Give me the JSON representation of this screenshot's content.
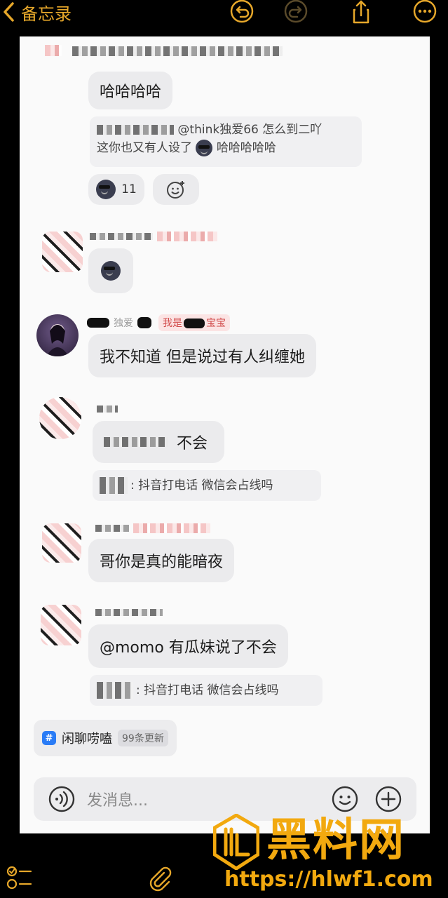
{
  "topbar": {
    "back_label": "备忘录"
  },
  "messages": {
    "m1_text": "哈哈哈哈",
    "m1_quote_ref": "@think独爱66 怎么到二吖",
    "m1_quote_text": "这你也又有人设了",
    "m1_quote_laugh": "哈哈哈哈哈",
    "m1_reaction_count": "11",
    "m3_name": "独爱",
    "m3_badge": "我是",
    "m3_badge_tail": "宝宝",
    "m3_text": "我不知道 但是说过有人纠缠她",
    "m4_text": "不会",
    "m4_quote": ": 抖音打电话 微信会占线吗",
    "m5_text": "哥你是真的能暗夜",
    "m6_text": "@momo  有瓜妹说了不会",
    "m6_quote": ": 抖音打电话 微信会占线吗"
  },
  "topic": {
    "label": "闲聊唠嗑",
    "count": "99条更新"
  },
  "input": {
    "placeholder": "发消息..."
  },
  "watermark": {
    "text": "黑料网",
    "url": "https://hlwf1.com"
  },
  "colors": {
    "accent": "#e6a72a",
    "watermark": "#f2a90f",
    "bubble": "#ebebed",
    "background": "#000000"
  }
}
